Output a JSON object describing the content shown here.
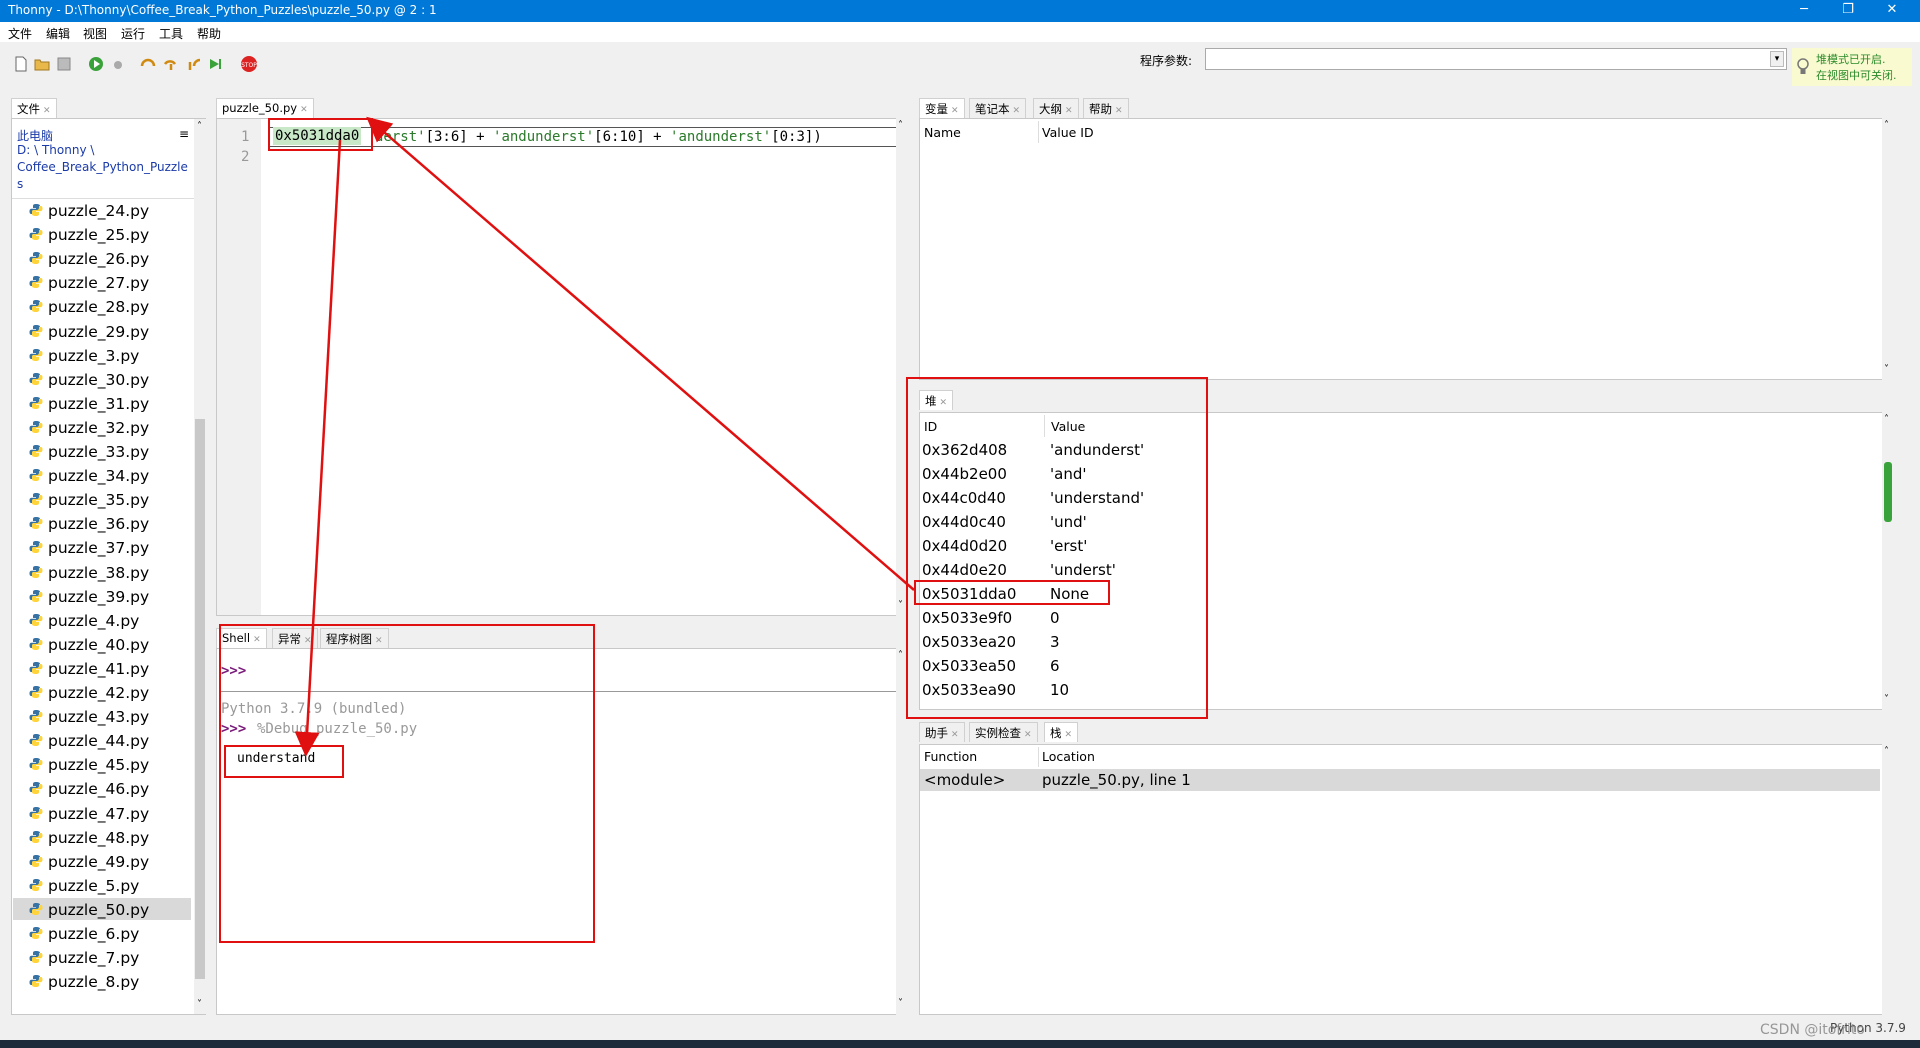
{
  "window": {
    "title": "Thonny  -  D:\\Thonny\\Coffee_Break_Python_Puzzles\\puzzle_50.py  @  2 : 1",
    "minimize": "─",
    "maximize": "❐",
    "close": "✕"
  },
  "menu": [
    "文件",
    "编辑",
    "视图",
    "运行",
    "工具",
    "帮助"
  ],
  "toolbar": {
    "args_label": "程序参数:",
    "notice_line1": "堆模式已开启.",
    "notice_line2": "在视图中可关闭."
  },
  "files_panel": {
    "tab": "文件",
    "location_label": "此电脑",
    "path_line1": "D: \\ Thonny \\",
    "path_line2": "Coffee_Break_Python_Puzzle",
    "path_line3": "s",
    "files": [
      "puzzle_24.py",
      "puzzle_25.py",
      "puzzle_26.py",
      "puzzle_27.py",
      "puzzle_28.py",
      "puzzle_29.py",
      "puzzle_3.py",
      "puzzle_30.py",
      "puzzle_31.py",
      "puzzle_32.py",
      "puzzle_33.py",
      "puzzle_34.py",
      "puzzle_35.py",
      "puzzle_36.py",
      "puzzle_37.py",
      "puzzle_38.py",
      "puzzle_39.py",
      "puzzle_4.py",
      "puzzle_40.py",
      "puzzle_41.py",
      "puzzle_42.py",
      "puzzle_43.py",
      "puzzle_44.py",
      "puzzle_45.py",
      "puzzle_46.py",
      "puzzle_47.py",
      "puzzle_48.py",
      "puzzle_49.py",
      "puzzle_5.py",
      "puzzle_50.py",
      "puzzle_6.py",
      "puzzle_7.py",
      "puzzle_8.py"
    ],
    "selected": "puzzle_50.py"
  },
  "editor": {
    "tab": "puzzle_50.py",
    "line_numbers": [
      "1",
      "2"
    ],
    "highlight": "0x5031dda0",
    "code_a": "derst'",
    "code_b": "[3:6] + ",
    "code_c": "'andunderst'",
    "code_d": "[6:10] + ",
    "code_e": "'andunderst'",
    "code_f": "[0:3])"
  },
  "shell": {
    "tabs": [
      "Shell",
      "异常",
      "程序树图"
    ],
    "prompt1": ">>>",
    "banner": "Python 3.7.9 (bundled)",
    "prompt2": ">>>",
    "command": "%Debug puzzle_50.py",
    "output": "understand"
  },
  "variables": {
    "tabs": [
      "变量",
      "笔记本",
      "大纲",
      "帮助"
    ],
    "col_name": "Name",
    "col_value": "Value ID"
  },
  "heap": {
    "tab": "堆",
    "col_id": "ID",
    "col_value": "Value",
    "rows": [
      {
        "id": "0x362d408",
        "value": "'andunderst'"
      },
      {
        "id": "0x44b2e00",
        "value": "'and'"
      },
      {
        "id": "0x44c0d40",
        "value": "'understand'"
      },
      {
        "id": "0x44d0c40",
        "value": "'und'"
      },
      {
        "id": "0x44d0d20",
        "value": "'erst'"
      },
      {
        "id": "0x44d0e20",
        "value": "'underst'"
      },
      {
        "id": "0x5031dda0",
        "value": "None"
      },
      {
        "id": "0x5033e9f0",
        "value": "0"
      },
      {
        "id": "0x5033ea20",
        "value": "3"
      },
      {
        "id": "0x5033ea50",
        "value": "6"
      },
      {
        "id": "0x5033ea90",
        "value": "10"
      }
    ]
  },
  "stack": {
    "tabs": [
      "助手",
      "实例检查",
      "栈"
    ],
    "col_function": "Function",
    "col_location": "Location",
    "row_function": "<module>",
    "row_location": "puzzle_50.py, line 1"
  },
  "status": {
    "python": "Python 3.7.9",
    "watermark": "CSDN @itofrito"
  }
}
